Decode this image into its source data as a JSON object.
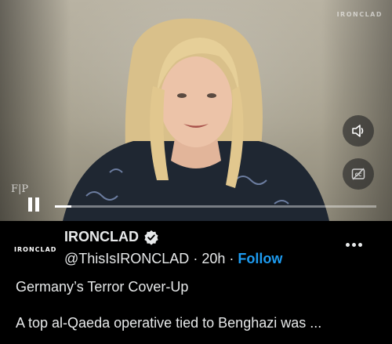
{
  "video": {
    "watermark": "IRONCLAD",
    "corner_logo": "F|P",
    "progress_fraction": 0.05,
    "controls": {
      "volume_icon": "speaker-icon",
      "captions_icon": "captions-off-icon",
      "play_state_icon": "pause-icon"
    }
  },
  "post": {
    "avatar_text": "IRONCLAD",
    "display_name": "IRONCLAD",
    "handle": "@ThisIsIRONCLAD",
    "separator": "·",
    "time": "20h",
    "follow_label": "Follow",
    "headline": "Germany’s Terror Cover-Up",
    "body": "A top al-Qaeda operative tied to Benghazi was ..."
  },
  "colors": {
    "accent": "#1d9bf0",
    "background": "#000000",
    "text": "#e7e9ea"
  }
}
